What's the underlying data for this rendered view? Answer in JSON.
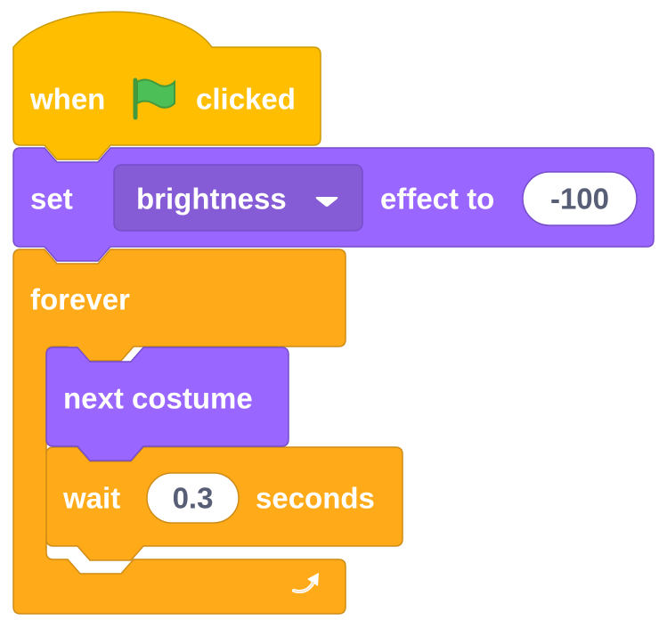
{
  "colors": {
    "events": "#ffbf00",
    "events_stroke": "#cc9900",
    "looks": "#9966ff",
    "looks_stroke": "#774dcb",
    "control": "#ffab19",
    "control_stroke": "#cf8b17",
    "flag": "#4cbf56",
    "input_text": "#575e75"
  },
  "hat_block": {
    "label_when": "when",
    "flag_icon": "green-flag-icon",
    "label_clicked": "clicked"
  },
  "set_effect_block": {
    "label_set": "set",
    "effect_dropdown": "brightness",
    "dropdown_icon": "triangle-down-icon",
    "label_effect_to": "effect to",
    "value": "-100"
  },
  "forever_block": {
    "label": "forever",
    "loop_icon": "loop-arrow-icon"
  },
  "next_costume_block": {
    "label": "next costume"
  },
  "wait_block": {
    "label_wait": "wait",
    "value": "0.3",
    "label_seconds": "seconds"
  }
}
